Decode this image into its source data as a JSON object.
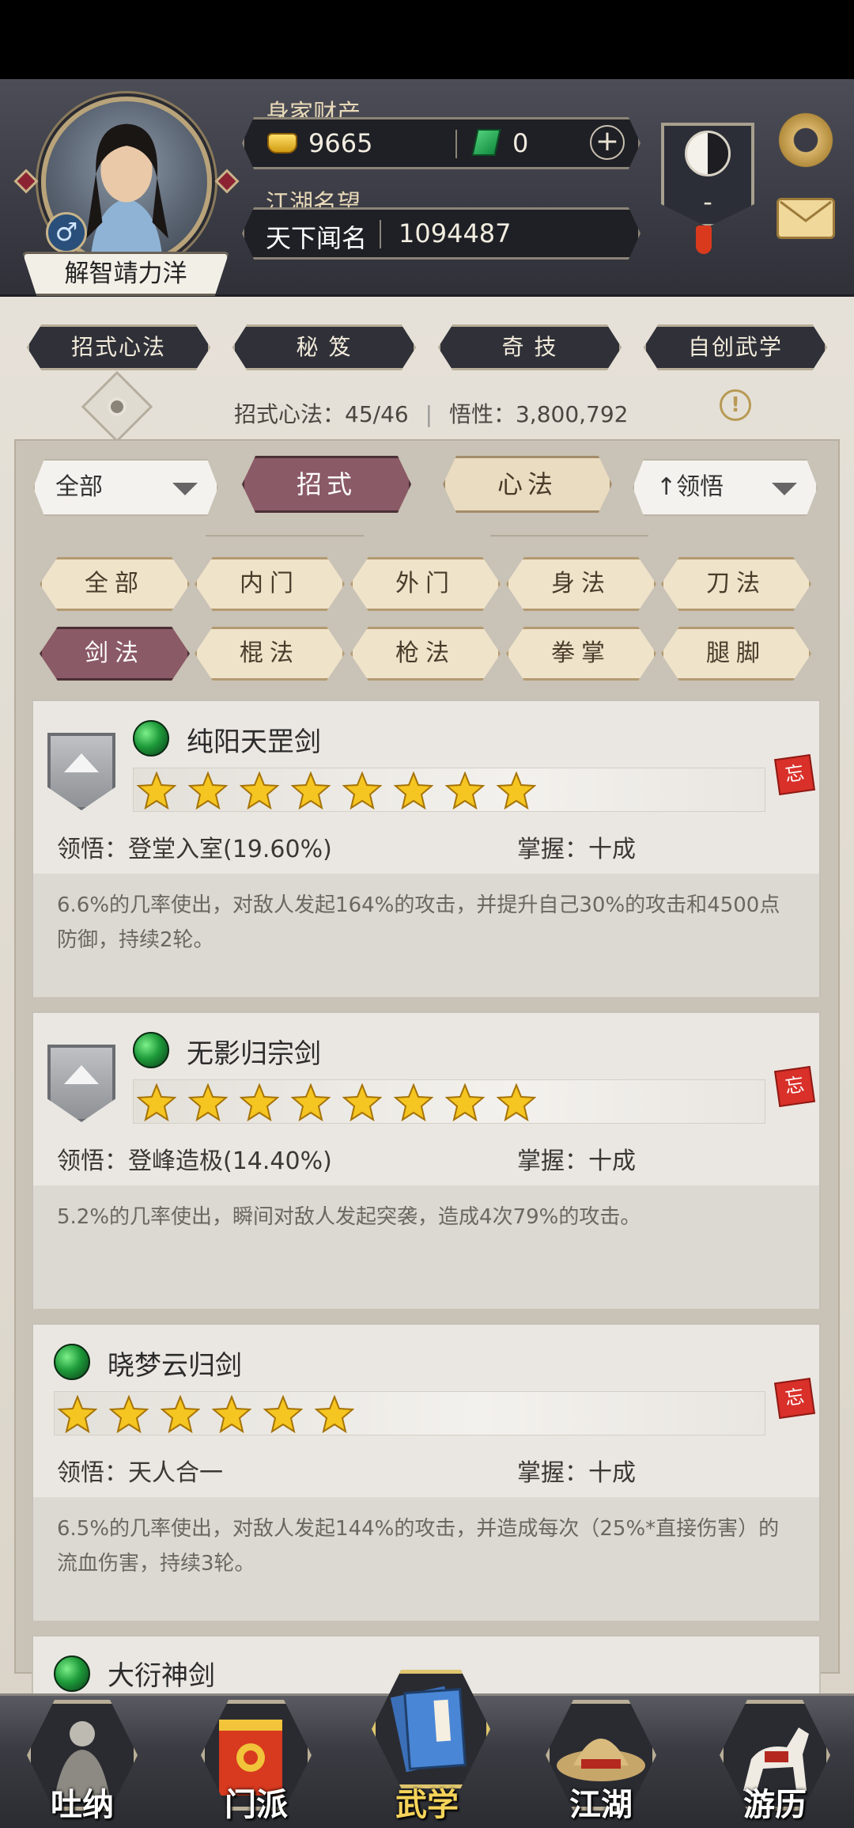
{
  "player": {
    "name": "解智靖力洋",
    "gender_symbol": "♂",
    "wealth_label": "身家财产",
    "gold": "9665",
    "jade": "0",
    "plus": "+",
    "fame_label": "江湖名望",
    "fame_title": "天下闻名",
    "fame_value": "1094487",
    "taiji_value": "-"
  },
  "category_tabs": [
    "招式心法",
    "秘 笈",
    "奇 技",
    "自创武学"
  ],
  "stats": {
    "skills_label": "招式心法：",
    "skills_value": "45/46",
    "insight_label": "悟性：",
    "insight_value": "3,800,792",
    "alert": "!"
  },
  "selectors": {
    "scope": "全部",
    "sort": "领悟",
    "sort_arrow": "↑"
  },
  "mode_tabs": [
    "招式",
    "心法"
  ],
  "filters": [
    "全部",
    "内门",
    "外门",
    "身法",
    "刀法",
    "剑法",
    "棍法",
    "枪法",
    "拳掌",
    "腿脚"
  ],
  "skills": [
    {
      "name": "纯阳天罡剑",
      "stars": 8,
      "insight_label": "领悟：",
      "insight": "登堂入室(19.60%)",
      "mastery_label": "掌握：",
      "mastery": "十成",
      "desc": "6.6%的几率使出，对敌人发起164%的攻击，并提升自己30%的攻击和4500点防御，持续2轮。",
      "tag": "忘"
    },
    {
      "name": "无影归宗剑",
      "stars": 8,
      "insight_label": "领悟：",
      "insight": "登峰造极(14.40%)",
      "mastery_label": "掌握：",
      "mastery": "十成",
      "desc": "5.2%的几率使出，瞬间对敌人发起突袭，造成4次79%的攻击。",
      "tag": "忘"
    },
    {
      "name": "晓梦云归剑",
      "stars": 6,
      "insight_label": "领悟：",
      "insight": "天人合一",
      "mastery_label": "掌握：",
      "mastery": "十成",
      "desc": "6.5%的几率使出，对敌人发起144%的攻击，并造成每次（25%*直接伤害）的流血伤害，持续3轮。",
      "tag": "忘"
    },
    {
      "name": "大衍神剑"
    }
  ],
  "bottom_nav": [
    "吐纳",
    "门派",
    "武学",
    "江湖",
    "游历"
  ],
  "colors": {
    "accent": "#8a5a66",
    "gold_text": "#f6d45a",
    "header_bg": "#3a3b44"
  }
}
